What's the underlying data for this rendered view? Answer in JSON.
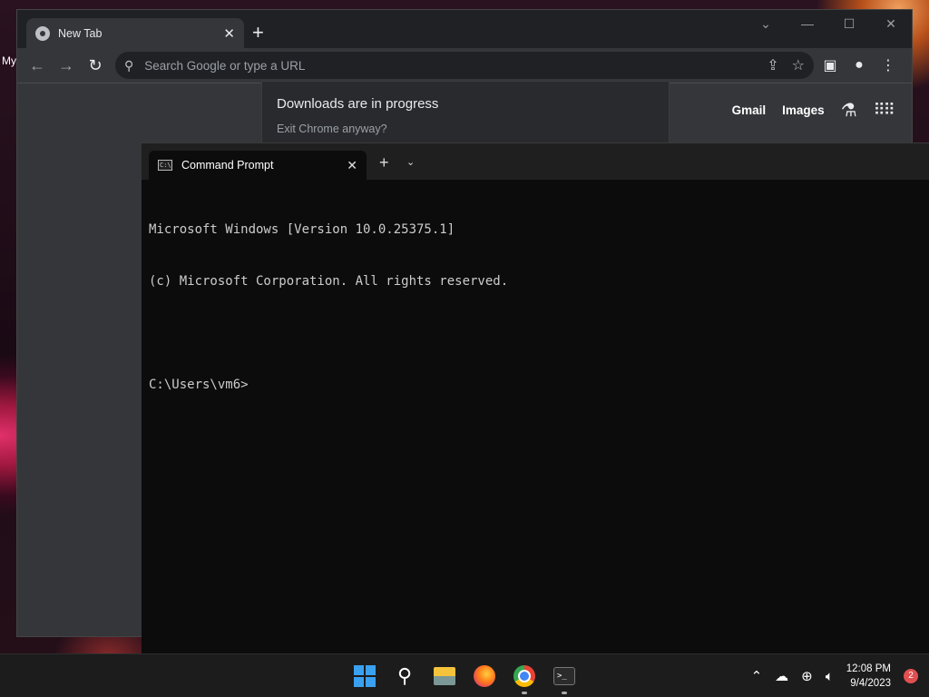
{
  "desktop": {
    "label": "My"
  },
  "chrome": {
    "tab_title": "New Tab",
    "omnibox_placeholder": "Search Google or type a URL",
    "download_popup": {
      "title": "Downloads are in progress",
      "subtitle": "Exit Chrome anyway?"
    },
    "ntp_links": {
      "gmail": "Gmail",
      "images": "Images"
    }
  },
  "terminal": {
    "tab_title": "Command Prompt",
    "lines": [
      "Microsoft Windows [Version 10.0.25375.1]",
      "(c) Microsoft Corporation. All rights reserved.",
      "",
      "C:\\Users\\vm6>"
    ]
  },
  "taskbar": {
    "apps": [
      "start",
      "search",
      "file-explorer",
      "firefox",
      "chrome",
      "terminal"
    ],
    "clock": {
      "time": "12:08 PM",
      "date": "9/4/2023"
    },
    "notification_count": "2"
  },
  "colors": {
    "chrome_frame": "#202124",
    "chrome_toolbar": "#35363a",
    "terminal_bg": "#0c0c0c",
    "taskbar_bg": "#1c1c1c",
    "windows_accent": "#3aa0f0"
  }
}
